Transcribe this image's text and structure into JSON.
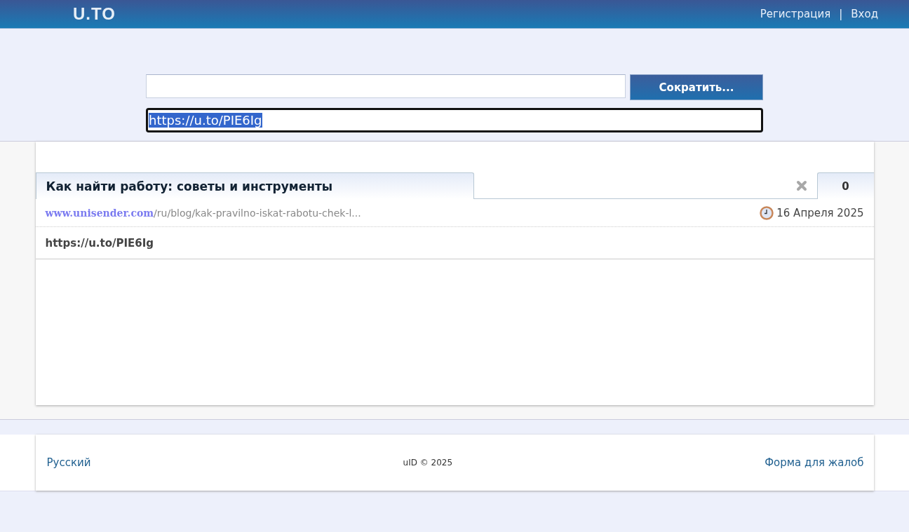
{
  "header": {
    "logo": "U.TO",
    "links": [
      {
        "label": "Регистрация"
      },
      {
        "label": "Вход"
      }
    ],
    "separator": "|"
  },
  "shortener": {
    "button": "Сократить...",
    "result": {
      "value": "https://u.to/PIE6Ig",
      "selected": true
    }
  },
  "link_card": {
    "title": "Как найти работу: советы и инструменты",
    "count": "0",
    "domain": "www.unisender.com",
    "path": "/ru/blog/kak-pravilno-iskat-rabotu-chek-l...",
    "date": "16 Апреля 2025",
    "short_url": "https://u.to/PIE6Ig"
  },
  "footer": {
    "language": "Русский",
    "copyright": "uID © 2025",
    "complaint": "Форма для жалоб"
  }
}
